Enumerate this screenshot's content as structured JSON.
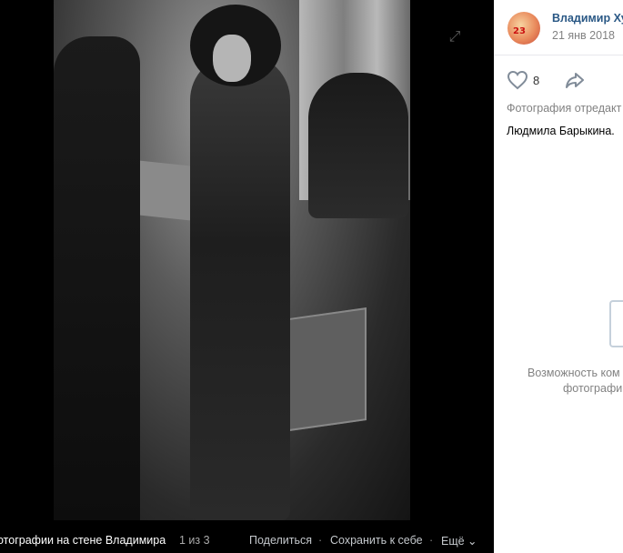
{
  "viewer": {
    "album_label": "отографии на стене Владимира",
    "counter": "1 из 3",
    "share_label": "Поделиться",
    "dot": "·",
    "save_label": "Сохранить к себе",
    "more_label": "Ещё ⌄"
  },
  "post": {
    "author": "Владимир Худ",
    "date": "21 янв 2018",
    "avatar_text": "23",
    "likes": "8",
    "edited_note": "Фотография отредакт",
    "caption": "Людмила Барыкина."
  },
  "comments": {
    "closed_line1": "Возможность ком",
    "closed_line2": "фотографи"
  }
}
